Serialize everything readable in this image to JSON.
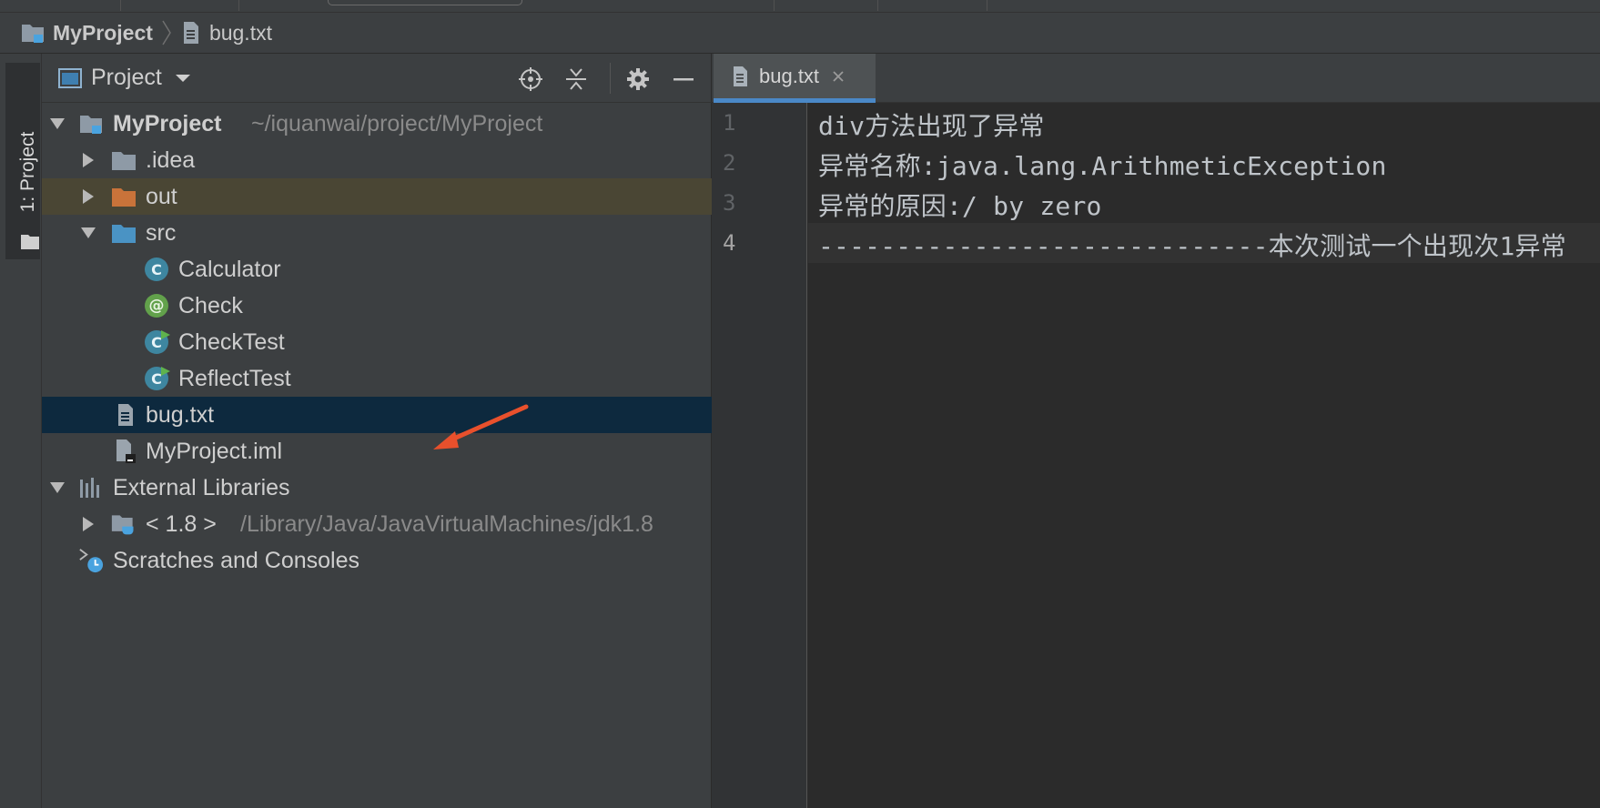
{
  "breadcrumb": {
    "project": "MyProject",
    "file": "bug.txt"
  },
  "side_tool_window": {
    "label": "1: Project"
  },
  "project_panel": {
    "title": "Project",
    "tree": {
      "root_name": "MyProject",
      "root_path": "~/iquanwai/project/MyProject",
      "idea": ".idea",
      "out": "out",
      "src": "src",
      "calculator": "Calculator",
      "check": "Check",
      "checktest": "CheckTest",
      "reflecttest": "ReflectTest",
      "bug_txt": "bug.txt",
      "iml": "MyProject.iml",
      "ext_libs": "External Libraries",
      "jdk_name": "< 1.8 >",
      "jdk_path": "/Library/Java/JavaVirtualMachines/jdk1.8",
      "scratches": "Scratches and Consoles"
    },
    "icons": {
      "class": "C",
      "annotation": "@"
    }
  },
  "editor": {
    "tab_label": "bug.txt",
    "line_numbers": [
      "1",
      "2",
      "3",
      "4"
    ],
    "lines": [
      "div方法出现了异常",
      "异常名称:java.lang.ArithmeticException",
      "异常的原因:/ by zero",
      "-----------------------------本次测试一个出现次1异常"
    ]
  },
  "colors": {
    "accent_tab": "#4a88c7",
    "selection": "#0d293e",
    "out_folder": "#c9733a",
    "folder": "#8e9aa6",
    "src_folder": "#4a93c4",
    "annotation_arrow": "#e8502c"
  }
}
